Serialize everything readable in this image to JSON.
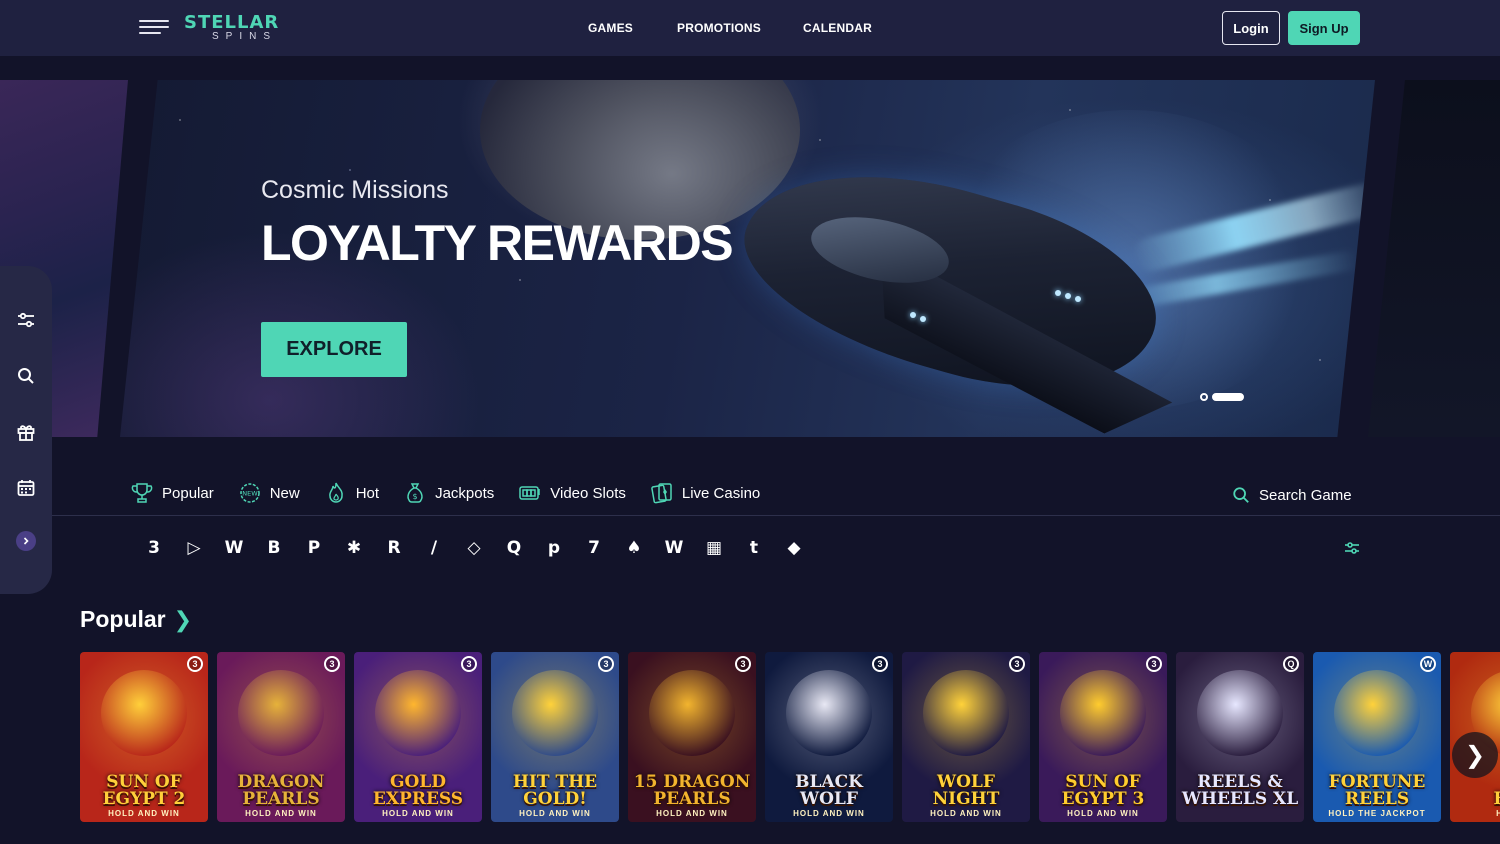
{
  "header": {
    "logo_main": "STELLAR",
    "logo_sub": "SPINS",
    "nav": [
      "GAMES",
      "PROMOTIONS",
      "CALENDAR"
    ],
    "login_label": "Login",
    "signup_label": "Sign Up"
  },
  "sidebar": {
    "icons": [
      "filter-icon",
      "search-icon",
      "gift-icon",
      "calendar-icon",
      "expand-chevron-icon"
    ]
  },
  "hero": {
    "subtitle": "Cosmic Missions",
    "title": "LOYALTY REWARDS",
    "cta_label": "EXPLORE",
    "slide_count": 2,
    "active_slide": 2
  },
  "categories": [
    {
      "label": "Popular",
      "icon": "trophy-icon"
    },
    {
      "label": "New",
      "icon": "new-badge-icon"
    },
    {
      "label": "Hot",
      "icon": "flame-icon"
    },
    {
      "label": "Jackpots",
      "icon": "money-bag-icon"
    },
    {
      "label": "Video Slots",
      "icon": "slot-machine-icon"
    },
    {
      "label": "Live Casino",
      "icon": "cards-icon"
    }
  ],
  "search_game_label": "Search Game",
  "providers": [
    "3",
    "▷",
    "W",
    "B",
    "P",
    "✱",
    "R",
    "/",
    "◇",
    "Q",
    "p",
    "7",
    "♠",
    "W",
    "▦",
    "t",
    "◆"
  ],
  "popular": {
    "title": "Popular",
    "games": [
      {
        "name": "SUN OF EGYPT 2",
        "tag": "HOLD AND WIN",
        "badge": "3",
        "bg": "#b8261a",
        "accent": "#ffcf3a"
      },
      {
        "name": "DRAGON PEARLS",
        "tag": "HOLD AND WIN",
        "badge": "3",
        "bg": "#6a1a5a",
        "accent": "#e6b23a"
      },
      {
        "name": "GOLD EXPRESS",
        "tag": "HOLD AND WIN",
        "badge": "3",
        "bg": "#4a1f7a",
        "accent": "#ffb62e"
      },
      {
        "name": "HIT THE GOLD!",
        "tag": "HOLD AND WIN",
        "badge": "3",
        "bg": "#2e4a8a",
        "accent": "#ffd23a"
      },
      {
        "name": "15 DRAGON PEARLS",
        "tag": "HOLD AND WIN",
        "badge": "3",
        "bg": "#3a1020",
        "accent": "#f2b42e"
      },
      {
        "name": "BLACK WOLF",
        "tag": "HOLD AND WIN",
        "badge": "3",
        "bg": "#0f1a3e",
        "accent": "#e8e8f4"
      },
      {
        "name": "WOLF NIGHT",
        "tag": "HOLD AND WIN",
        "badge": "3",
        "bg": "#1f1a44",
        "accent": "#ffd23a"
      },
      {
        "name": "SUN OF EGYPT 3",
        "tag": "HOLD AND WIN",
        "badge": "3",
        "bg": "#3a1a5a",
        "accent": "#ffcc2e"
      },
      {
        "name": "REELS & WHEELS XL",
        "tag": "",
        "badge": "Q",
        "bg": "#2a1d3e",
        "accent": "#e7e7ff"
      },
      {
        "name": "FORTUNE REELS",
        "tag": "HOLD THE JACKPOT",
        "badge": "W",
        "bg": "#1a5ab0",
        "accent": "#ffd23a"
      },
      {
        "name": "FOR",
        "tag": "HOLD T",
        "badge": "",
        "bg": "#b02a10",
        "accent": "#ffcf3a"
      }
    ]
  },
  "colors": {
    "accent": "#4fd6b5",
    "nav_bg": "#1f2140",
    "page_bg": "#121329"
  }
}
